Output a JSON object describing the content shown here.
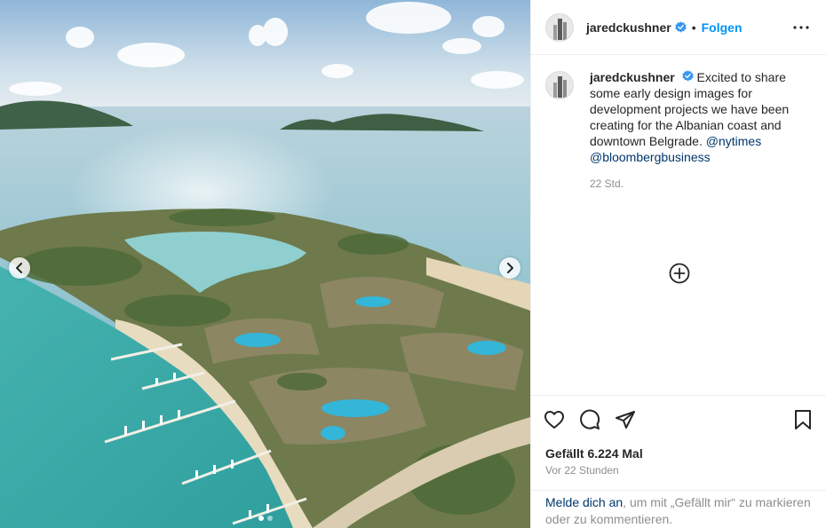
{
  "post": {
    "username": "jaredckushner",
    "separator": "•",
    "follow_label": "Folgen",
    "caption": {
      "text_1": "Excited to share some early design images for development projects we have been creating for the Albanian coast and downtown Belgrade. ",
      "mention_1": "@nytimes",
      "mention_2": "@bloombergbusiness",
      "time": "22 Std."
    },
    "likes": "Gefällt 6.224 Mal",
    "posted_ago": "Vor 22 Stunden"
  },
  "login_prompt": {
    "link": "Melde dich an",
    "rest": ", um mit „Gefällt mir“ zu markieren oder zu kommentieren."
  },
  "icons": {
    "verified": "verified-badge-icon",
    "more": "more-options-icon",
    "load_comments": "plus-circle-icon",
    "like": "heart-icon",
    "comment": "comment-icon",
    "share": "paper-plane-icon",
    "save": "bookmark-icon",
    "prev": "chevron-left-icon",
    "next": "chevron-right-icon"
  },
  "carousel": {
    "slides": 2,
    "active": 1
  },
  "colors": {
    "accent": "#0095f6",
    "link": "#00376b",
    "muted": "#8e8e8e",
    "text": "#262626"
  }
}
